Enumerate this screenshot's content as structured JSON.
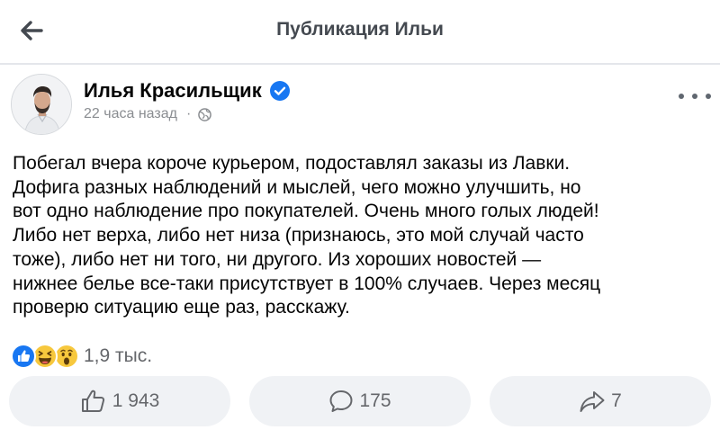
{
  "header": {
    "title": "Публикация Ильи",
    "back_icon": "arrow-left-icon"
  },
  "post": {
    "author_name": "Илья Красильщик",
    "verified_icon": "verified-badge-icon",
    "time_ago": "22 часа назад",
    "separator": "·",
    "audience_icon": "globe-icon",
    "more_icon": "ellipsis-icon",
    "text": "Побегал вчера короче курьером, подоставлял заказы из Лавки.\nДофига разных наблюдений и мыслей, чего можно улучшить, но\nвот одно наблюдение про покупателей. Очень много голых людей!\nЛибо нет верха, либо нет низа (признаюсь, это мой случай часто\nтоже), либо нет ни того, ни другого. Из хороших новостей —\nнижнее белье все-таки присутствует в 100% случаев. Через месяц\nпроверю ситуацию еще раз, расскажу."
  },
  "reactions": {
    "icons": [
      "like-reaction-icon",
      "haha-reaction-icon",
      "wow-reaction-icon"
    ],
    "count": "1,9 тыс."
  },
  "actions": {
    "like": {
      "icon": "thumbs-up-icon",
      "count": "1 943"
    },
    "comment": {
      "icon": "comment-bubble-icon",
      "count": "175"
    },
    "share": {
      "icon": "share-arrow-icon",
      "count": "7"
    }
  },
  "colors": {
    "verified_blue": "#1877f2",
    "secondary_text": "#65676b",
    "button_bg": "#f0f2f5"
  }
}
